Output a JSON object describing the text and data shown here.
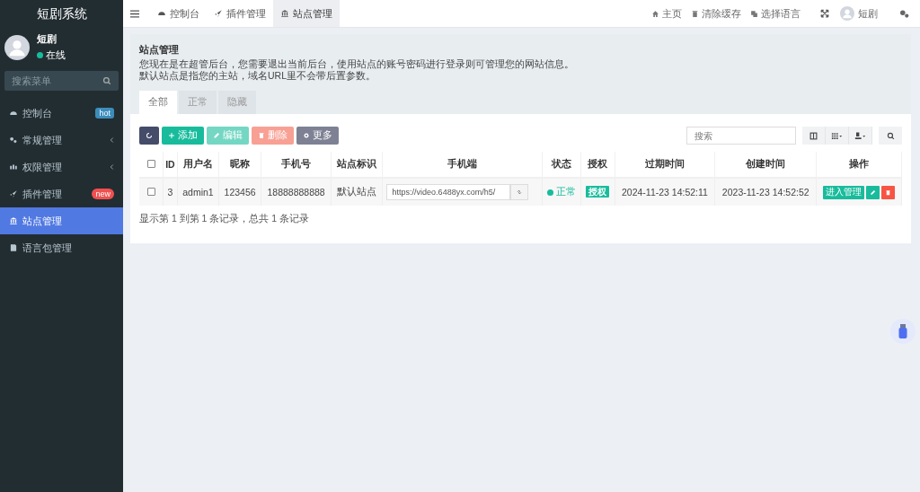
{
  "sidebar": {
    "brand": "短剧系统",
    "user": {
      "name": "短剧",
      "status": "在线"
    },
    "search": {
      "placeholder": "搜索菜单"
    },
    "items": [
      {
        "label": "控制台",
        "badge": "hot",
        "has_submenu": false,
        "selected": false
      },
      {
        "label": "常规管理",
        "has_submenu": true,
        "selected": false
      },
      {
        "label": "权限管理",
        "has_submenu": true,
        "selected": false
      },
      {
        "label": "插件管理",
        "badge": "new",
        "has_submenu": false,
        "selected": false
      },
      {
        "label": "站点管理",
        "has_submenu": false,
        "selected": true
      },
      {
        "label": "语言包管理",
        "has_submenu": false,
        "selected": false
      }
    ]
  },
  "topbar": {
    "tabs": [
      {
        "label": "控制台",
        "selected": false
      },
      {
        "label": "插件管理",
        "selected": false
      },
      {
        "label": "站点管理",
        "selected": true
      }
    ],
    "links": [
      "主页",
      "清除缓存",
      "选择语言"
    ],
    "user": "短剧"
  },
  "panel": {
    "title": "站点管理",
    "lines": [
      "您现在是在超管后台，您需要退出当前后台，使用站点的账号密码进行登录则可管理您的网站信息。",
      "默认站点是指您的主站，域名URL里不会带后置参数。"
    ],
    "tabs": [
      {
        "label": "全部",
        "selected": true
      },
      {
        "label": "正常",
        "selected": false
      },
      {
        "label": "隐藏",
        "selected": false
      }
    ],
    "toolbar": [
      {
        "kind": "refresh"
      },
      {
        "kind": "add",
        "label": "添加"
      },
      {
        "kind": "edit",
        "label": "编辑"
      },
      {
        "kind": "delete",
        "label": "删除"
      },
      {
        "kind": "more",
        "label": "更多"
      }
    ],
    "search": {
      "placeholder": "搜索"
    },
    "table": {
      "all_checked": false,
      "columns": [
        "ID",
        "用户名",
        "昵称",
        "手机号",
        "站点标识",
        "手机端",
        "状态",
        "授权",
        "过期时间",
        "创建时间",
        "操作"
      ],
      "rows": [
        {
          "checked": false,
          "id": "3",
          "username": "admin1",
          "nickname": "123456",
          "phone": "18888888888",
          "site": "默认站点",
          "mobile_url": "https://video.6488yx.com/h5/",
          "status": "正常",
          "auth": "授权",
          "expire": "2024-11-23 14:52:11",
          "created": "2023-11-23 14:52:52",
          "manage": "进入管理"
        }
      ]
    },
    "pagination": "显示第 1 到第 1 条记录，总共 1 条记录"
  }
}
